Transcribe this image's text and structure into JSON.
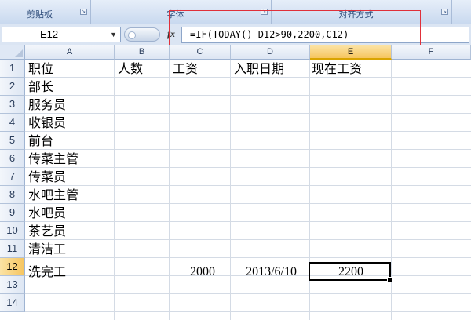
{
  "ribbon": {
    "groups": [
      "剪贴板",
      "字体",
      "对齐方式"
    ]
  },
  "formula_bar": {
    "name_box": "E12",
    "fx_label": "fx",
    "formula": "=IF(TODAY()-D12>90,2200,C12)"
  },
  "grid": {
    "columns": [
      "A",
      "B",
      "C",
      "D",
      "E",
      "F"
    ],
    "selected_column": "E",
    "rows": [
      "1",
      "2",
      "3",
      "4",
      "5",
      "6",
      "7",
      "8",
      "9",
      "10",
      "11",
      "12",
      "13",
      "14"
    ],
    "selected_row": "12",
    "headers": {
      "A": "职位",
      "B": "人数",
      "C": "工资",
      "D": "入职日期",
      "E": "现在工资"
    },
    "positions": [
      "部长",
      "服务员",
      "收银员",
      "前台",
      "传菜主管",
      "传菜员",
      "水吧主管",
      "水吧员",
      "茶艺员",
      "清洁工",
      "洗完工"
    ],
    "row12": {
      "salary": "2000",
      "hire_date": "2013/6/10",
      "current_salary": "2200"
    }
  },
  "colors": {
    "annotation_box": "#e0303a",
    "selected_header": "#f6c55f"
  }
}
